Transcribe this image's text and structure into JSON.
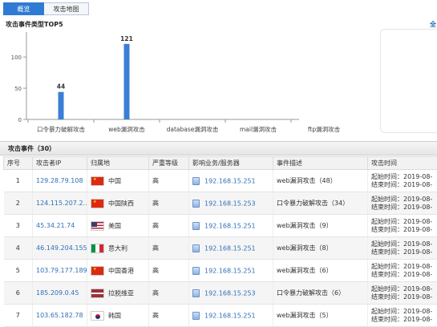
{
  "tabs": [
    {
      "label": "概览",
      "active": true
    },
    {
      "label": "攻击地图",
      "active": false
    }
  ],
  "chart_title": "攻击事件类型TOP5",
  "right_link": "全",
  "chart_data": {
    "type": "bar",
    "title": "攻击事件类型TOP5",
    "categories": [
      "口令暴力破解攻击",
      "web漏洞攻击",
      "database漏洞攻击",
      "mail漏洞攻击",
      "ftp漏洞攻击"
    ],
    "values": [
      44,
      121,
      0,
      0,
      0
    ],
    "data_labels": [
      "44",
      "121",
      "",
      "",
      ""
    ],
    "yticks": [
      "0",
      "50",
      "100"
    ],
    "ylim": [
      0,
      140
    ],
    "bar_color": "#3a7fd5",
    "grid": false
  },
  "events": {
    "title": "攻击事件（30）",
    "columns": [
      "序号",
      "攻击者IP",
      "归属地",
      "严重等级",
      "影响业务/服务器",
      "事件描述",
      "攻击时间"
    ],
    "rows": [
      {
        "idx": "1",
        "ip": "129.28.79.108",
        "flag": "cn",
        "region": "中国",
        "severity": "高",
        "server": "192.168.15.251",
        "desc": "web漏洞攻击（48）",
        "start": "起始时间：2019-08-",
        "end": "结束时间：2019-08-"
      },
      {
        "idx": "2",
        "ip": "124.115.207.2...",
        "flag": "cn",
        "region": "中国陕西",
        "severity": "高",
        "server": "192.168.15.253",
        "desc": "口令暴力破解攻击（34）",
        "start": "起始时间：2019-08-",
        "end": "结束时间：2019-08-"
      },
      {
        "idx": "3",
        "ip": "45.34.21.74",
        "flag": "us",
        "region": "美国",
        "severity": "高",
        "server": "192.168.15.251",
        "desc": "web漏洞攻击（9）",
        "start": "起始时间：2019-08-",
        "end": "结束时间：2019-08-"
      },
      {
        "idx": "4",
        "ip": "46.149.204.155",
        "flag": "it",
        "region": "意大利",
        "severity": "高",
        "server": "192.168.15.251",
        "desc": "web漏洞攻击（8）",
        "start": "起始时间：2019-08-",
        "end": "结束时间：2019-08-"
      },
      {
        "idx": "5",
        "ip": "103.79.177.189",
        "flag": "cn",
        "region": "中国香港",
        "severity": "高",
        "server": "192.168.15.251",
        "desc": "web漏洞攻击（6）",
        "start": "起始时间：2019-08-",
        "end": "结束时间：2019-08-"
      },
      {
        "idx": "6",
        "ip": "185.209.0.45",
        "flag": "lv",
        "region": "拉脱维亚",
        "severity": "高",
        "server": "192.168.15.253",
        "desc": "口令暴力破解攻击（6）",
        "start": "起始时间：2019-08-",
        "end": "结束时间：2019-08-"
      },
      {
        "idx": "7",
        "ip": "103.65.182.78",
        "flag": "kr",
        "region": "韩国",
        "severity": "高",
        "server": "192.168.15.251",
        "desc": "web漏洞攻击（5）",
        "start": "起始时间：2019-08-",
        "end": "结束时间：2019-08-"
      }
    ]
  }
}
